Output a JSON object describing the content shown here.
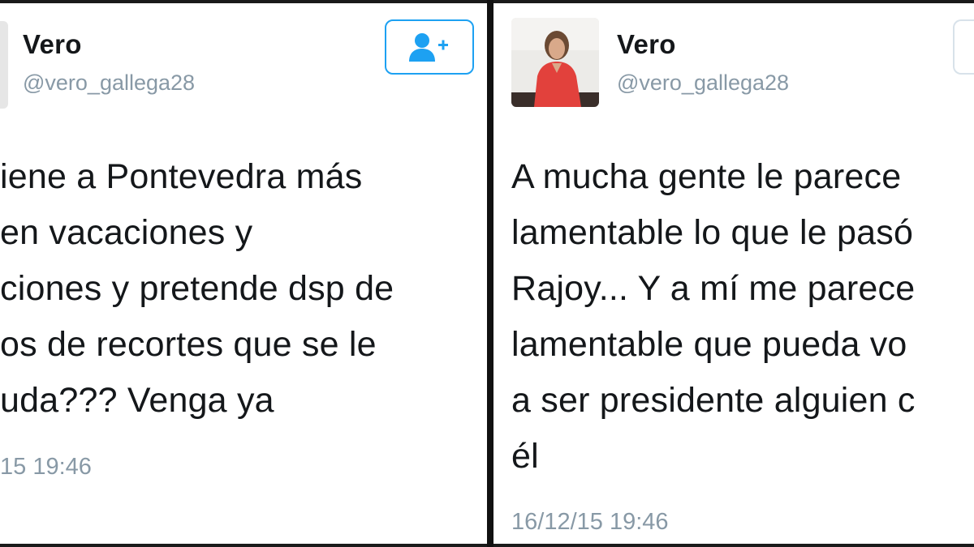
{
  "left_tweet": {
    "name": "Vero",
    "handle": "@vero_gallega28",
    "text_lines": [
      "iene a Pontevedra más",
      "en vacaciones y",
      "ciones y pretende dsp de",
      "os de recortes que se le",
      "uda??? Venga ya"
    ],
    "timestamp": "15 19:46",
    "follow_icon": "add-user-icon"
  },
  "right_tweet": {
    "name": "Vero",
    "handle": "@vero_gallega28",
    "text_lines": [
      "A mucha gente le parece",
      "lamentable lo que le pasó",
      "Rajoy... Y a mí me parece",
      "lamentable que pueda vo",
      "a ser presidente alguien c",
      "él"
    ],
    "timestamp": "16/12/15 19:46"
  },
  "colors": {
    "accent": "#1da1f2",
    "text": "#14171a",
    "muted": "#8899a6",
    "background": "#ffffff",
    "frame": "#111111"
  }
}
